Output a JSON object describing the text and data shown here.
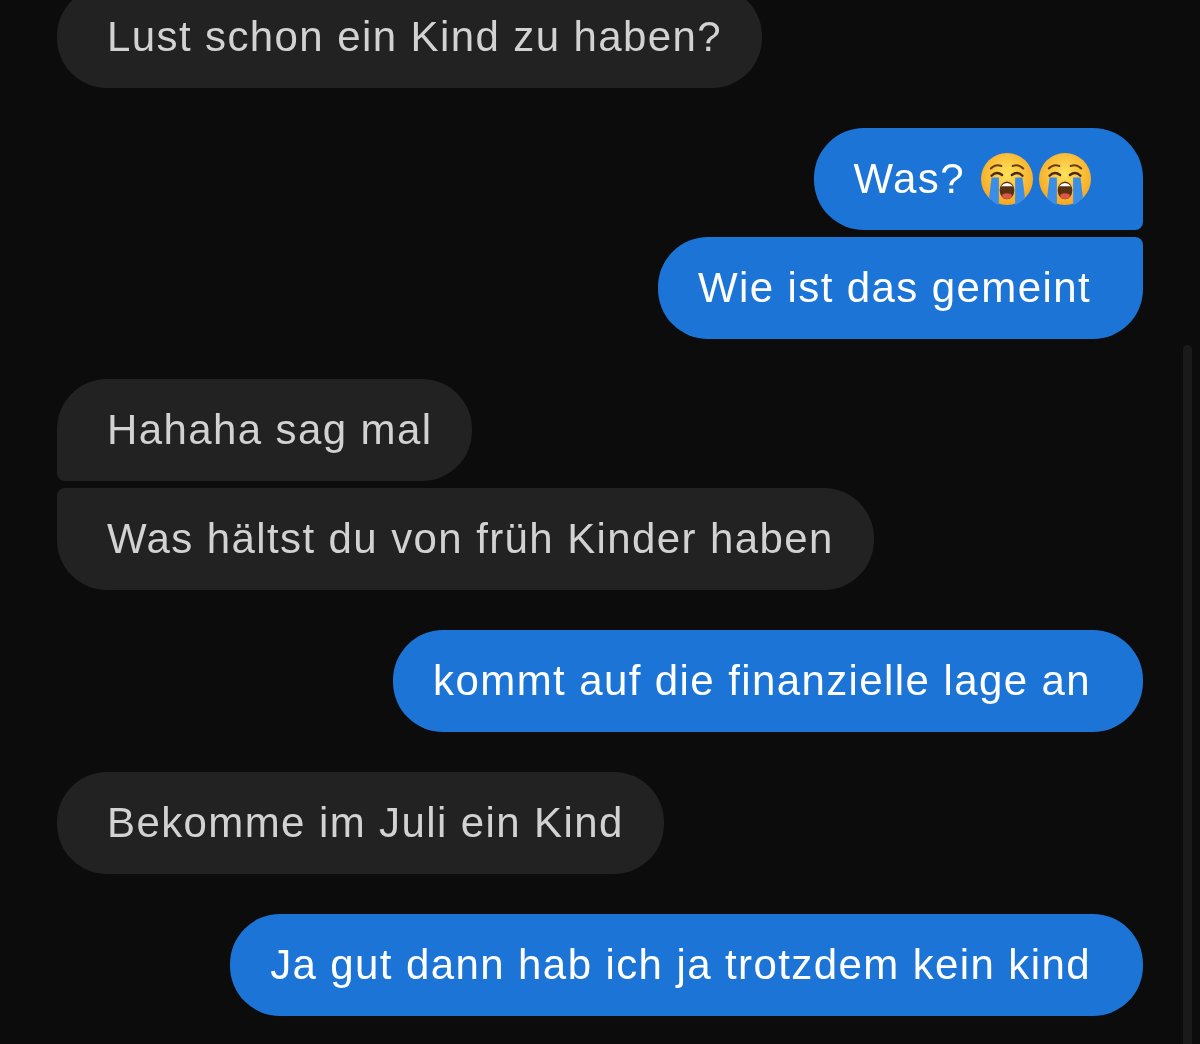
{
  "messages": [
    {
      "kind": "received",
      "text": "Lust schon ein Kind zu haben?"
    },
    {
      "kind": "sent",
      "text": "Was?",
      "emojis": [
        {
          "kind": "loudly-crying"
        },
        {
          "kind": "loudly-crying"
        }
      ]
    },
    {
      "kind": "sent",
      "text": "Wie ist das gemeint"
    },
    {
      "kind": "received",
      "text": "Hahaha sag mal"
    },
    {
      "kind": "received",
      "text": "Was hältst du von früh Kinder haben"
    },
    {
      "kind": "sent",
      "text": "kommt auf die finanzielle lage an"
    },
    {
      "kind": "received",
      "text": "Bekomme im Juli ein Kind"
    },
    {
      "kind": "sent",
      "text": "Ja gut dann hab ich ja trotzdem kein kind"
    }
  ]
}
